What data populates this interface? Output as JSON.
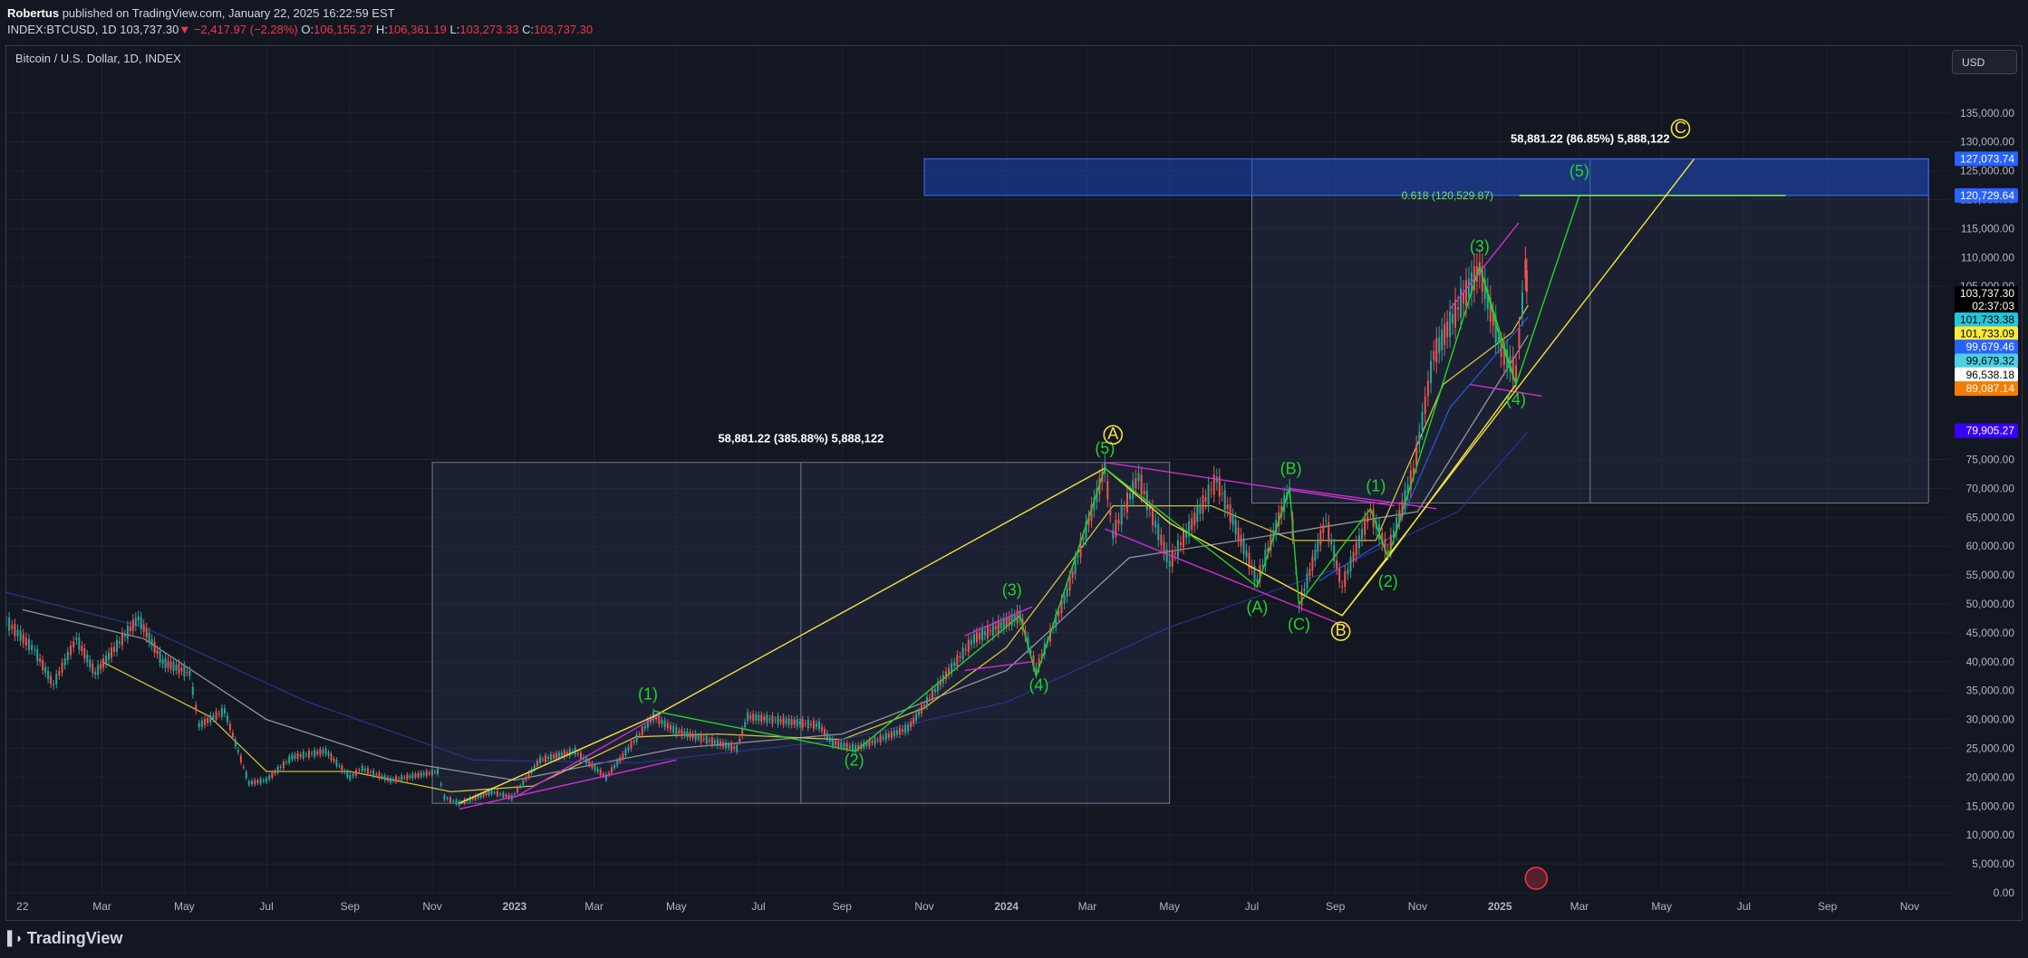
{
  "header": {
    "author": "Robertus",
    "published": "published on TradingView.com, January 22, 2025 16:22:59 EST",
    "symbol": "INDEX:BTCUSD, 1D",
    "last": "103,737.30",
    "change": "−2,417.97 (−2.28%)",
    "open_label": "O:",
    "open": "106,155.27",
    "high_label": "H:",
    "high": "106,361.19",
    "low_label": "L:",
    "low": "103,273.33",
    "close_label": "C:",
    "close": "103,737.30"
  },
  "chart_title": "Bitcoin / U.S. Dollar, 1D, INDEX",
  "currency_button": "USD",
  "footer": {
    "brand": "TradingView"
  },
  "colors": {
    "background": "#131722",
    "grid": "#1f2330",
    "axis_text": "#b2b5be",
    "wave_green": "#22d32a",
    "wave_yellow": "#f5e33a",
    "channel": "#d02fd0",
    "target_zone": "#1d4ed8",
    "fib_line": "#6ee75a",
    "range_box": "#2a3550"
  },
  "chart_data": {
    "type": "line",
    "title": "Bitcoin / U.S. Dollar, 1D, INDEX",
    "xlabel": "",
    "ylabel": "",
    "x_range": [
      "2021-12-20",
      "2025-12-01"
    ],
    "ylim": [
      0,
      145000
    ],
    "y_ticks": [
      0,
      5000,
      10000,
      15000,
      20000,
      25000,
      30000,
      35000,
      40000,
      45000,
      50000,
      55000,
      60000,
      65000,
      70000,
      75000,
      105000,
      110000,
      115000,
      120000,
      125000,
      130000,
      135000
    ],
    "y_tick_labels": [
      "0.00",
      "5,000.00",
      "10,000.00",
      "15,000.00",
      "20,000.00",
      "25,000.00",
      "30,000.00",
      "35,000.00",
      "40,000.00",
      "45,000.00",
      "50,000.00",
      "55,000.00",
      "60,000.00",
      "65,000.00",
      "70,000.00",
      "75,000.00",
      "105,000.00",
      "110,000.00",
      "115,000.00",
      "120,000.00",
      "125,000.00",
      "130,000.00",
      "135,000.00"
    ],
    "x_ticks": [
      {
        "date": "2022-01-01",
        "label": "22"
      },
      {
        "date": "2022-03-01",
        "label": "Mar"
      },
      {
        "date": "2022-05-01",
        "label": "May"
      },
      {
        "date": "2022-07-01",
        "label": "Jul"
      },
      {
        "date": "2022-09-01",
        "label": "Sep"
      },
      {
        "date": "2022-11-01",
        "label": "Nov"
      },
      {
        "date": "2023-01-01",
        "label": "2023"
      },
      {
        "date": "2023-03-01",
        "label": "Mar"
      },
      {
        "date": "2023-05-01",
        "label": "May"
      },
      {
        "date": "2023-07-01",
        "label": "Jul"
      },
      {
        "date": "2023-09-01",
        "label": "Sep"
      },
      {
        "date": "2023-11-01",
        "label": "Nov"
      },
      {
        "date": "2024-01-01",
        "label": "2024"
      },
      {
        "date": "2024-03-01",
        "label": "Mar"
      },
      {
        "date": "2024-05-01",
        "label": "May"
      },
      {
        "date": "2024-07-01",
        "label": "Jul"
      },
      {
        "date": "2024-09-01",
        "label": "Sep"
      },
      {
        "date": "2024-11-01",
        "label": "Nov"
      },
      {
        "date": "2025-01-01",
        "label": "2025"
      },
      {
        "date": "2025-03-01",
        "label": "Mar"
      },
      {
        "date": "2025-05-01",
        "label": "May"
      },
      {
        "date": "2025-07-01",
        "label": "Jul"
      },
      {
        "date": "2025-09-01",
        "label": "Sep"
      },
      {
        "date": "2025-11-01",
        "label": "Nov"
      }
    ],
    "price_path": [
      [
        "2021-12-20",
        47000
      ],
      [
        "2022-01-10",
        42000
      ],
      [
        "2022-01-24",
        36000
      ],
      [
        "2022-02-10",
        44000
      ],
      [
        "2022-02-24",
        38000
      ],
      [
        "2022-03-28",
        47500
      ],
      [
        "2022-04-15",
        40000
      ],
      [
        "2022-05-05",
        38000
      ],
      [
        "2022-05-12",
        29000
      ],
      [
        "2022-05-31",
        31500
      ],
      [
        "2022-06-18",
        19000
      ],
      [
        "2022-07-01",
        19500
      ],
      [
        "2022-07-20",
        23500
      ],
      [
        "2022-08-14",
        24500
      ],
      [
        "2022-09-01",
        20000
      ],
      [
        "2022-09-10",
        21500
      ],
      [
        "2022-10-01",
        19500
      ],
      [
        "2022-11-05",
        21000
      ],
      [
        "2022-11-10",
        16500
      ],
      [
        "2022-11-21",
        15500
      ],
      [
        "2022-12-15",
        17500
      ],
      [
        "2022-12-30",
        16500
      ],
      [
        "2023-01-20",
        23000
      ],
      [
        "2023-02-15",
        24500
      ],
      [
        "2023-03-10",
        20000
      ],
      [
        "2023-04-14",
        30500
      ],
      [
        "2023-05-01",
        28000
      ],
      [
        "2023-06-15",
        25000
      ],
      [
        "2023-06-23",
        30500
      ],
      [
        "2023-08-15",
        29000
      ],
      [
        "2023-08-25",
        26000
      ],
      [
        "2023-09-11",
        25000
      ],
      [
        "2023-10-20",
        28500
      ],
      [
        "2023-11-15",
        37000
      ],
      [
        "2023-12-08",
        44000
      ],
      [
        "2024-01-11",
        48000
      ],
      [
        "2024-01-23",
        38500
      ],
      [
        "2024-02-15",
        52000
      ],
      [
        "2024-03-14",
        73500
      ],
      [
        "2024-03-20",
        62000
      ],
      [
        "2024-04-08",
        72000
      ],
      [
        "2024-05-01",
        57000
      ],
      [
        "2024-06-05",
        71500
      ],
      [
        "2024-07-05",
        54000
      ],
      [
        "2024-07-29",
        70000
      ],
      [
        "2024-08-05",
        49500
      ],
      [
        "2024-08-25",
        64500
      ],
      [
        "2024-09-06",
        53000
      ],
      [
        "2024-09-27",
        66000
      ],
      [
        "2024-10-10",
        59000
      ],
      [
        "2024-10-29",
        73000
      ],
      [
        "2024-11-13",
        93000
      ],
      [
        "2024-12-05",
        103000
      ],
      [
        "2024-12-17",
        108000
      ],
      [
        "2025-01-02",
        94000
      ],
      [
        "2025-01-13",
        90000
      ],
      [
        "2025-01-20",
        108000
      ],
      [
        "2025-01-22",
        103737
      ]
    ],
    "series": [
      {
        "name": "",
        "color": "#ffeb3b",
        "values": [
          [
            45000,
            44000
          ],
          [
            "2022-03-01",
            40000
          ],
          [
            "2022-05-20",
            30500
          ],
          [
            "2022-07-01",
            21000
          ],
          [
            "2022-09-01",
            21000
          ],
          [
            "2022-11-15",
            17500
          ],
          [
            "2023-01-15",
            18500
          ],
          [
            "2023-04-01",
            27000
          ],
          [
            "2023-06-01",
            27500
          ],
          [
            "2023-09-01",
            26500
          ],
          [
            "2023-11-01",
            32000
          ],
          [
            "2024-01-01",
            42500
          ],
          [
            "2024-03-20",
            67000
          ],
          [
            "2024-06-01",
            67000
          ],
          [
            "2024-08-01",
            61000
          ],
          [
            "2024-10-01",
            61000
          ],
          [
            "2024-11-20",
            88000
          ],
          [
            "2025-01-10",
            97000
          ],
          [
            "2025-01-22",
            101733
          ]
        ]
      },
      {
        "name": "",
        "color": "#2962ff",
        "values": [
          [
            "2024-08-20",
            54000
          ],
          [
            "2024-10-15",
            62000
          ],
          [
            "2024-11-25",
            84000
          ],
          [
            "2025-01-22",
            99679
          ]
        ]
      },
      {
        "name": "",
        "color": "#b0b3ba",
        "values": [
          [
            "2022-01-01",
            49000
          ],
          [
            "2022-04-01",
            44000
          ],
          [
            "2022-07-01",
            30000
          ],
          [
            "2022-10-01",
            23000
          ],
          [
            "2023-01-01",
            19500
          ],
          [
            "2023-05-01",
            25000
          ],
          [
            "2023-09-01",
            27500
          ],
          [
            "2024-01-01",
            38500
          ],
          [
            "2024-04-01",
            58000
          ],
          [
            "2024-08-01",
            62500
          ],
          [
            "2024-11-01",
            66000
          ],
          [
            "2025-01-22",
            96538
          ]
        ]
      },
      {
        "name": "",
        "color": "#2a3a9a",
        "values": [
          [
            "2021-12-20",
            52000
          ],
          [
            "2022-04-01",
            46000
          ],
          [
            "2022-08-01",
            33000
          ],
          [
            "2022-12-01",
            23000
          ],
          [
            "2023-04-01",
            22500
          ],
          [
            "2023-09-01",
            26500
          ],
          [
            "2024-01-01",
            33000
          ],
          [
            "2024-05-01",
            46000
          ],
          [
            "2024-09-01",
            56000
          ],
          [
            "2024-12-01",
            66000
          ],
          [
            "2025-01-22",
            79905
          ]
        ]
      }
    ],
    "price_labels": [
      {
        "text": "127,073.74",
        "value": 127073.74,
        "bg": "#2962ff",
        "fg": "#ffffff"
      },
      {
        "text": "120,729.64",
        "value": 120729.64,
        "bg": "#2962ff",
        "fg": "#ffffff"
      },
      {
        "text": "103,737.30",
        "value": 103737.3,
        "bg": "#000000",
        "fg": "#ffffff"
      },
      {
        "text": "02:37:03",
        "value": 101600,
        "bg": "#000000",
        "fg": "#ffffff"
      },
      {
        "text": "101,733.38",
        "value": 99200,
        "bg": "#26c6da",
        "fg": "#000000"
      },
      {
        "text": "101,733.09",
        "value": 96800,
        "bg": "#ffeb3b",
        "fg": "#000000"
      },
      {
        "text": "99,679.46",
        "value": 94500,
        "bg": "#2962ff",
        "fg": "#ffffff"
      },
      {
        "text": "99,679.32",
        "value": 92100,
        "bg": "#4dd0e1",
        "fg": "#000000"
      },
      {
        "text": "96,538.18",
        "value": 89700,
        "bg": "#ffffff",
        "fg": "#000000"
      },
      {
        "text": "89,087.14",
        "value": 87300,
        "bg": "#f57c00",
        "fg": "#ffffff"
      },
      {
        "text": "79,905.27",
        "value": 80000,
        "bg": "#3700ff",
        "fg": "#ffffff"
      }
    ],
    "range_measure_1": {
      "x0": "2022-11-01",
      "x1": "2024-05-01",
      "y0": 15500,
      "y1": 74500,
      "label": "58,881.22 (385.88%) 5,888,122"
    },
    "range_measure_2": {
      "x0": "2024-07-01",
      "x1": "2025-11-15",
      "y0": 67500,
      "y1": 127073.74,
      "label": "58,881.22 (86.85%) 5,888,122"
    },
    "target_zone": {
      "x0": "2023-11-01",
      "x1": "2025-11-15",
      "y0": 120729.64,
      "y1": 127073.74
    },
    "fib_line": {
      "x0": "2024-10-20",
      "x1": "2025-08-01",
      "value": 120729.64,
      "label": "0.618 (120,529.87)"
    },
    "wave_labels": [
      {
        "text": "(1)",
        "date": "2023-04-10",
        "value": 33500,
        "color": "#22d32a"
      },
      {
        "text": "(2)",
        "date": "2023-09-10",
        "value": 22000,
        "color": "#22d32a"
      },
      {
        "text": "(3)",
        "date": "2024-01-05",
        "value": 51500,
        "color": "#22d32a"
      },
      {
        "text": "(4)",
        "date": "2024-01-25",
        "value": 35000,
        "color": "#22d32a"
      },
      {
        "text": "(5)",
        "date": "2024-03-14",
        "value": 76000,
        "color": "#22d32a"
      },
      {
        "text": "A",
        "date": "2024-03-20",
        "value": 78500,
        "color": "#f5e33a",
        "circle": true
      },
      {
        "text": "(A)",
        "date": "2024-07-05",
        "value": 48500,
        "color": "#22d32a"
      },
      {
        "text": "(B)",
        "date": "2024-07-30",
        "value": 72500,
        "color": "#22d32a"
      },
      {
        "text": "(C)",
        "date": "2024-08-05",
        "value": 45500,
        "color": "#22d32a"
      },
      {
        "text": "B",
        "date": "2024-09-05",
        "value": 44500,
        "color": "#f5e33a",
        "circle": true
      },
      {
        "text": "(1)",
        "date": "2024-10-01",
        "value": 69500,
        "color": "#22d32a"
      },
      {
        "text": "(2)",
        "date": "2024-10-10",
        "value": 53000,
        "color": "#22d32a"
      },
      {
        "text": "(3)",
        "date": "2024-12-17",
        "value": 111000,
        "color": "#22d32a"
      },
      {
        "text": "(4)",
        "date": "2025-01-13",
        "value": 84500,
        "color": "#22d32a"
      },
      {
        "text": "(5)",
        "date": "2025-03-01",
        "value": 124000,
        "color": "#22d32a"
      },
      {
        "text": "C",
        "date": "2025-05-15",
        "value": 131500,
        "color": "#f5e33a",
        "circle": true
      }
    ],
    "wave_lines": [
      {
        "color": "#f5e33a",
        "points": [
          [
            "2022-11-21",
            15500
          ],
          [
            "2023-04-14",
            30500
          ],
          [
            "2024-03-14",
            73500
          ],
          [
            "2024-05-01",
            64000
          ],
          [
            "2024-09-06",
            48000
          ],
          [
            "2025-05-25",
            127000
          ]
        ]
      },
      {
        "color": "#f5e33a",
        "points": [
          [
            "2024-09-06",
            48000
          ],
          [
            "2024-10-10",
            58000
          ],
          [
            "2025-01-13",
            88000
          ]
        ]
      },
      {
        "color": "#22d32a",
        "points": [
          [
            "2023-04-14",
            31500
          ],
          [
            "2023-09-11",
            24500
          ],
          [
            "2024-01-11",
            48000
          ],
          [
            "2024-01-23",
            37500
          ],
          [
            "2024-03-14",
            73500
          ]
        ]
      },
      {
        "color": "#22d32a",
        "points": [
          [
            "2024-03-14",
            73500
          ],
          [
            "2024-07-05",
            53000
          ],
          [
            "2024-07-29",
            70000
          ],
          [
            "2024-08-05",
            50000
          ],
          [
            "2024-09-27",
            66500
          ],
          [
            "2024-10-10",
            58000
          ],
          [
            "2024-12-17",
            108500
          ],
          [
            "2025-01-13",
            88000
          ],
          [
            "2025-03-01",
            120700
          ]
        ]
      },
      {
        "color": "#22d32a",
        "points": [
          [
            "2024-12-17",
            108500
          ],
          [
            "2025-01-01",
            96000
          ],
          [
            "2025-01-13",
            88000
          ]
        ]
      }
    ],
    "channel_lines": [
      {
        "points": [
          [
            "2022-11-21",
            14500
          ],
          [
            "2023-05-01",
            23000
          ]
        ]
      },
      {
        "points": [
          [
            "2023-01-01",
            16500
          ],
          [
            "2023-04-20",
            31000
          ]
        ]
      },
      {
        "points": [
          [
            "2023-12-01",
            44500
          ],
          [
            "2024-01-20",
            49500
          ]
        ]
      },
      {
        "points": [
          [
            "2023-12-01",
            38500
          ],
          [
            "2024-01-20",
            40000
          ]
        ]
      },
      {
        "points": [
          [
            "2024-03-14",
            74500
          ],
          [
            "2024-10-15",
            67000
          ]
        ]
      },
      {
        "points": [
          [
            "2024-03-14",
            63000
          ],
          [
            "2024-09-10",
            46000
          ]
        ]
      },
      {
        "points": [
          [
            "2024-07-29",
            70000
          ],
          [
            "2024-11-15",
            66500
          ]
        ]
      },
      {
        "points": [
          [
            "2024-11-25",
            101000
          ],
          [
            "2025-01-15",
            116000
          ]
        ]
      },
      {
        "points": [
          [
            "2024-12-10",
            88000
          ],
          [
            "2025-02-01",
            86000
          ]
        ]
      }
    ]
  }
}
